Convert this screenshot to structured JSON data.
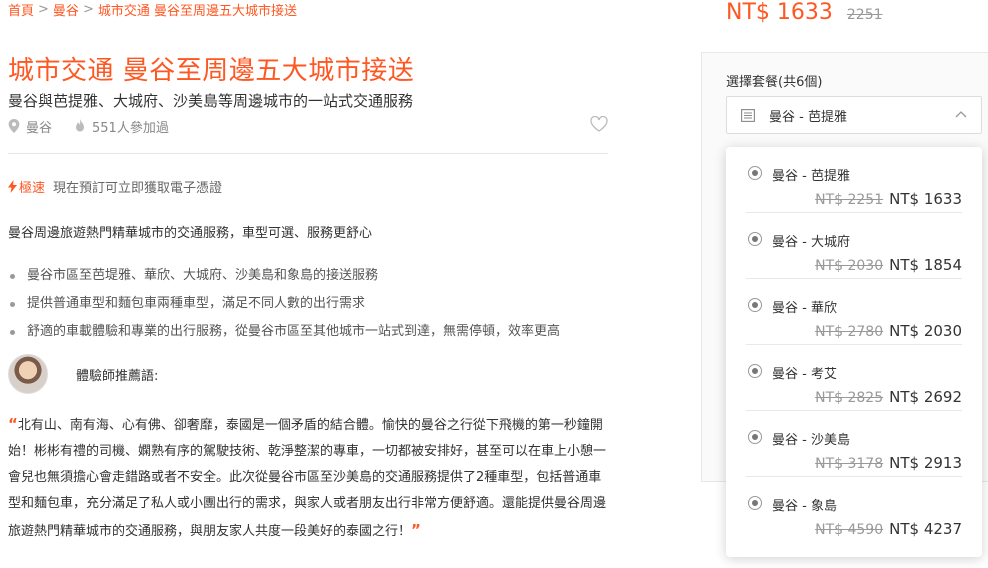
{
  "breadcrumb": [
    "首頁",
    "曼谷",
    "城市交通 曼谷至周邊五大城市接送"
  ],
  "breadcrumb_sep": ">",
  "title": "城市交通 曼谷至周邊五大城市接送",
  "subtitle": "曼谷與芭提雅、大城府、沙美島等周邊城市的一站式交通服務",
  "meta": {
    "location": "曼谷",
    "participants": "551人參加過"
  },
  "fast": {
    "label": "極速",
    "text": "現在預訂可立即獲取電子憑證"
  },
  "intro": "曼谷周邊旅遊熱門精華城市的交通服務，車型可選、服務更舒心",
  "bullets": [
    "曼谷市區至芭堤雅、華欣、大城府、沙美島和象島的接送服務",
    "提供普通車型和麵包車兩種車型，滿足不同人數的出行需求",
    "舒適的車載體驗和專業的出行服務，從曼谷市區至其他城市一站式到達，無需停頓，效率更高"
  ],
  "recommend_label": "體驗師推薦語:",
  "quote_open": "“",
  "quote_close": "”",
  "quote": "北有山、南有海、心有佛、卻奢靡，泰國是一個矛盾的結合體。愉快的曼谷之行從下飛機的第一秒鐘開始！彬彬有禮的司機、嫻熟有序的駕駛技術、乾淨整潔的專車，一切都被安排好，甚至可以在車上小憩一會兒也無須擔心會走錯路或者不安全。此次從曼谷市區至沙美島的交通服務提供了2種車型，包括普通車型和麵包車，充分滿足了私人或小團出行的需求，與家人或者朋友出行非常方便舒適。還能提供曼谷周邊旅遊熱門精華城市的交通服務，與朋友家人共度一段美好的泰國之行！",
  "price": {
    "now": "NT$ 1633",
    "orig": "2251"
  },
  "package_label": "選擇套餐(共6個)",
  "selected_package": "曼谷 - 芭提雅",
  "options": [
    {
      "name": "曼谷 - 芭提雅",
      "orig": "NT$ 2251",
      "now": "NT$ 1633"
    },
    {
      "name": "曼谷 - 大城府",
      "orig": "NT$ 2030",
      "now": "NT$ 1854"
    },
    {
      "name": "曼谷 - 華欣",
      "orig": "NT$ 2780",
      "now": "NT$ 2030"
    },
    {
      "name": "曼谷 - 考艾",
      "orig": "NT$ 2825",
      "now": "NT$ 2692"
    },
    {
      "name": "曼谷 - 沙美島",
      "orig": "NT$ 3178",
      "now": "NT$ 2913"
    },
    {
      "name": "曼谷 - 象島",
      "orig": "NT$ 4590",
      "now": "NT$ 4237"
    }
  ],
  "colors": {
    "accent": "#ff5722",
    "text": "#333333",
    "muted": "#999999"
  },
  "icons": {
    "location": "map-pin-icon",
    "participants": "flame-icon",
    "favorite": "heart-icon",
    "fast": "lightning-icon",
    "select": "list-icon",
    "chevron": "chevron-up-icon"
  }
}
